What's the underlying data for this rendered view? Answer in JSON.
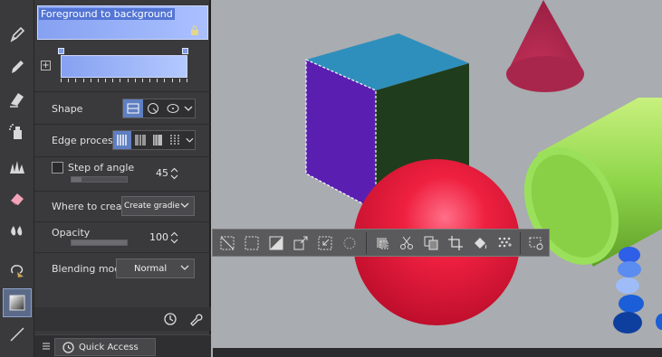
{
  "gradient_name": "Foreground to background",
  "shape": {
    "label": "Shape"
  },
  "edge_process": {
    "label": "Edge process"
  },
  "step_of_angle": {
    "label": "Step of angle",
    "value": "45",
    "checked": false
  },
  "where_to_create": {
    "label": "Where to create",
    "selected": "Create gradient"
  },
  "opacity": {
    "label": "Opacity",
    "value": "100",
    "fill_percent": 100
  },
  "blending_mode": {
    "label": "Blending mode",
    "selected": "Normal"
  },
  "quick_access": {
    "label": "Quick Access"
  },
  "colors": {
    "accent": "#5f7fc2",
    "gradient_start": "#86a1f1",
    "gradient_end": "#b4c9ff",
    "cube_top": "#2f8fbc",
    "cube_left": "#5a1fb0",
    "cube_right": "#1f3d1c",
    "sphere": "#e8193a",
    "cone": "#b3294e",
    "cylinder": "#8fd64a"
  },
  "toolbar_icons": [
    "pen-icon",
    "pencil-icon",
    "eraser-icon",
    "airbrush-icon",
    "decoration-icon",
    "blend-icon",
    "fill-icon",
    "lasso-fill-icon",
    "gradient-icon",
    "line-icon"
  ],
  "selection_launcher_icons": [
    "deselect-icon",
    "select-all-icon",
    "invert-selection-icon",
    "expand-selection-icon",
    "shrink-selection-icon",
    "selection-settings-icon",
    "clear-icon",
    "cut-icon",
    "copy-icon",
    "crop-icon",
    "fill-selection-icon",
    "tone-selection-icon",
    "selection-launcher-settings-icon"
  ]
}
